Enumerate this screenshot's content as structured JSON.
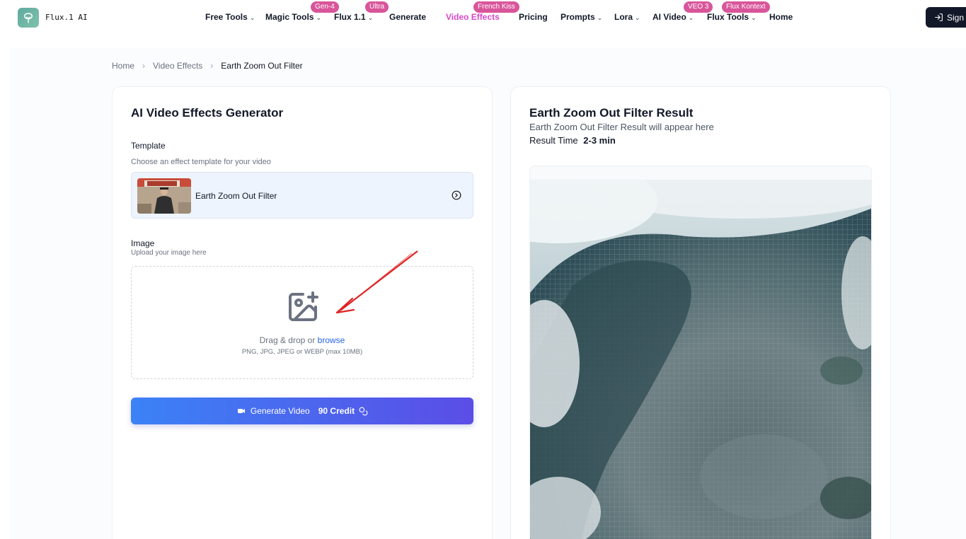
{
  "header": {
    "brand": "Flux.1 AI",
    "nav": [
      {
        "label": "Free Tools",
        "chevron": true
      },
      {
        "label": "Magic Tools",
        "chevron": true,
        "badge": "Gen-4"
      },
      {
        "label": "Flux 1.1",
        "chevron": true,
        "badge": "Ultra"
      },
      {
        "label": "Generate",
        "chevron": false
      },
      {
        "label": "Video Effects",
        "chevron": false,
        "badge": "French Kiss",
        "active": true
      },
      {
        "label": "Pricing",
        "chevron": false
      },
      {
        "label": "Prompts",
        "chevron": true
      },
      {
        "label": "Lora",
        "chevron": true
      },
      {
        "label": "AI Video",
        "chevron": true,
        "badge": "VEO 3"
      },
      {
        "label": "Flux Tools",
        "chevron": true,
        "badge": "Flux Kontext"
      },
      {
        "label": "Home",
        "chevron": false
      }
    ],
    "sign_label": "Sign"
  },
  "breadcrumb": {
    "items": [
      "Home",
      "Video Effects",
      "Earth Zoom Out Filter"
    ],
    "separator": "›"
  },
  "generator": {
    "title": "AI Video Effects Generator",
    "template_label": "Template",
    "template_hint": "Choose an effect template for your video",
    "template_name": "Earth Zoom Out Filter",
    "image_label": "Image",
    "image_hint": "Upload your image here",
    "upload_text": "Drag & drop or",
    "upload_link": "browse",
    "upload_formats": "PNG, JPG, JPEG or WEBP (max 10MB)",
    "generate_label": "Generate Video",
    "credit_label": "90 Credit"
  },
  "result": {
    "title": "Earth Zoom Out Filter Result",
    "subtitle": "Earth Zoom Out Filter Result will appear here",
    "time_label": "Result Time",
    "time_value": "2-3 min"
  },
  "colors": {
    "accent": "#d946c9",
    "badge": "#d9559a",
    "button_start": "#3b82f6",
    "button_end": "#5b4de6",
    "arrow": "#e02424"
  }
}
